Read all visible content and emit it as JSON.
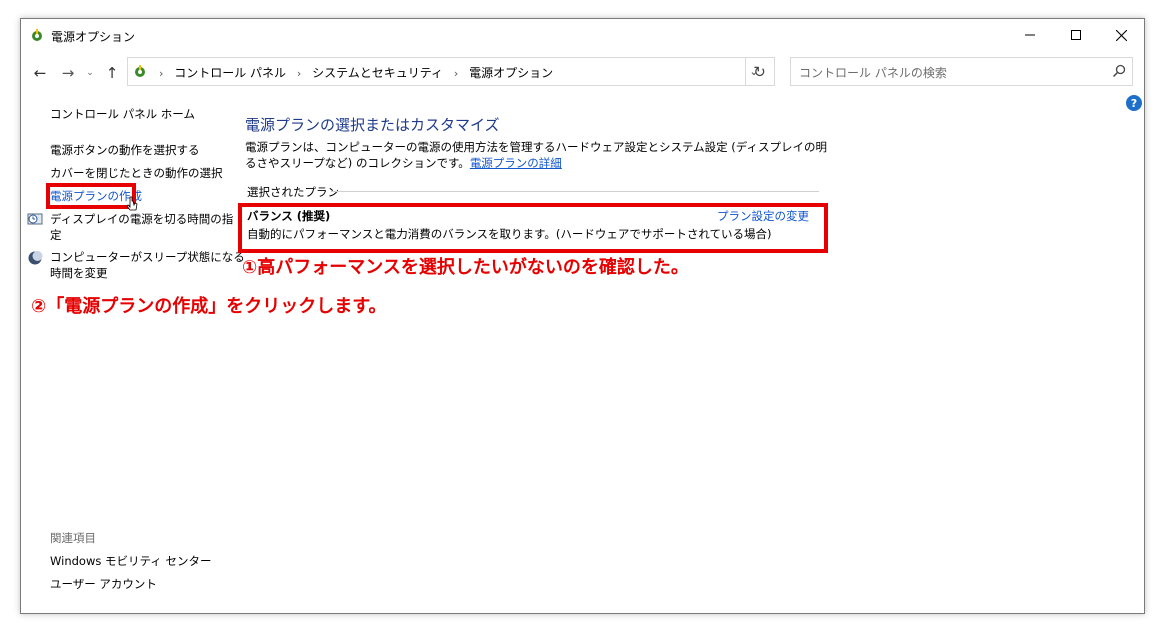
{
  "window": {
    "title": "電源オプション"
  },
  "address": {
    "breadcrumb": [
      "コントロール パネル",
      "システムとセキュリティ",
      "電源オプション"
    ],
    "search_placeholder": "コントロール パネルの検索"
  },
  "sidebar": {
    "home": "コントロール パネル ホーム",
    "items": [
      "電源ボタンの動作を選択する",
      "カバーを閉じたときの動作の選択",
      "電源プランの作成",
      "ディスプレイの電源を切る時間の指定",
      "コンピューターがスリープ状態になる時間を変更"
    ],
    "display_line1": "ディスプレイの電源を切る時間の指",
    "display_line2": "定",
    "sleep_line1": "コンピューターがスリープ状態になる",
    "sleep_line2": "時間を変更",
    "related_heading": "関連項目",
    "related_items": [
      "Windows モビリティ センター",
      "ユーザー アカウント"
    ]
  },
  "main": {
    "title": "電源プランの選択またはカスタマイズ",
    "description": "電源プランは、コンピューターの電源の使用方法を管理するハードウェア設定とシステム設定 (ディスプレイの明るさやスリープなど) のコレクションです。",
    "description_link": "電源プランの詳細",
    "selected_plan_header": "選択されたプラン",
    "plan": {
      "name": "バランス (推奨)",
      "description": "自動的にパフォーマンスと電力消費のバランスを取ります。(ハードウェアでサポートされている場合)",
      "settings_link": "プラン設定の変更"
    }
  },
  "annotations": {
    "step1": "①高パフォーマンスを選択したいがないのを確認した。",
    "step2": "②「電源プランの作成」をクリックします。"
  },
  "colors": {
    "link": "#1155cc",
    "title": "#1e3a8a",
    "annotation": "#e60000"
  },
  "icons": {
    "window": "power-options-icon",
    "help": "help-icon",
    "search": "search-icon"
  }
}
